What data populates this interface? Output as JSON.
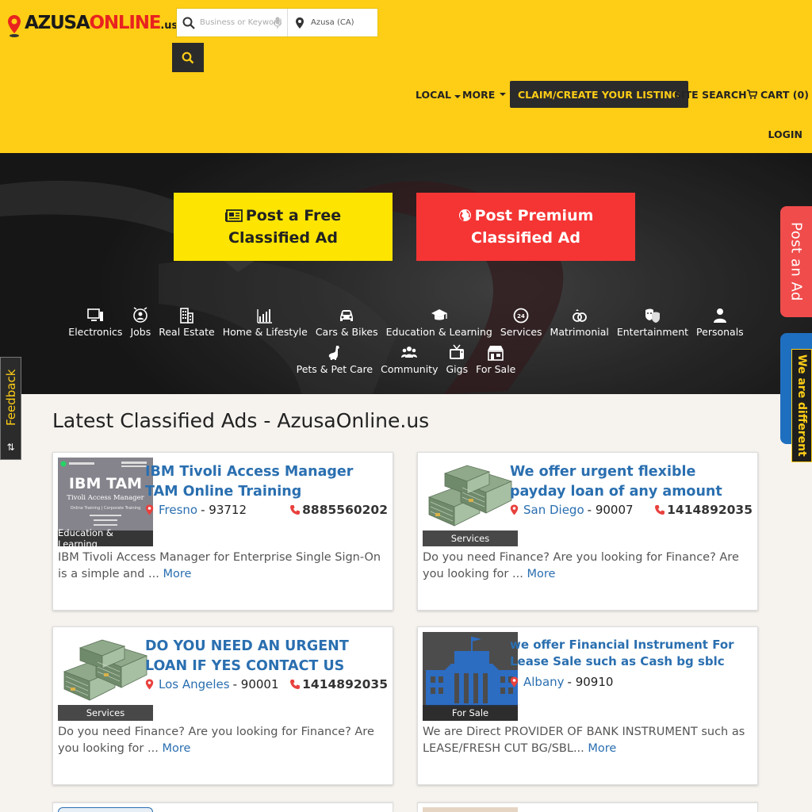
{
  "header": {
    "logo": {
      "main": "AZUSA",
      "accent": "ONLINE",
      "tld": ".us"
    },
    "search": {
      "keyword_placeholder": "Business or Keyword",
      "location_value": "Azusa (CA)",
      "icons": [
        "search-icon",
        "microphone-icon",
        "map-marker-icon"
      ]
    },
    "nav": {
      "local": "LOCAL",
      "more": "MORE",
      "claim": "CLAIM/CREATE YOUR LISTING",
      "site_search": "SITE SEARCH",
      "cart": "CART (0)",
      "login": "LOGIN"
    },
    "colors": {
      "brand_yellow": "#fecd16",
      "dark": "#2b2b2b",
      "link_blue": "#2a6fb0",
      "red": "#f43534"
    }
  },
  "hero": {
    "post_free": "Post a Free Classified Ad",
    "post_premium": "Post Premium Classified Ad",
    "categories_row1": [
      {
        "label": "Electronics",
        "icon": "monitor-icon"
      },
      {
        "label": "Jobs",
        "icon": "clock-user-icon"
      },
      {
        "label": "Real Estate",
        "icon": "building-icon"
      },
      {
        "label": "Home & Lifestyle",
        "icon": "chart-house-icon"
      },
      {
        "label": "Cars & Bikes",
        "icon": "car-icon"
      },
      {
        "label": "Education & Learning",
        "icon": "graduation-cap-icon"
      },
      {
        "label": "Services",
        "icon": "24h-service-icon"
      },
      {
        "label": "Matrimonial",
        "icon": "rings-icon"
      },
      {
        "label": "Entertainment",
        "icon": "theater-icon"
      },
      {
        "label": "Personals",
        "icon": "person-icon"
      }
    ],
    "categories_row2": [
      {
        "label": "Pets & Pet Care",
        "icon": "dog-icon"
      },
      {
        "label": "Community",
        "icon": "group-icon"
      },
      {
        "label": "Gigs",
        "icon": "tv-icon"
      },
      {
        "label": "For Sale",
        "icon": "shop-icon"
      }
    ]
  },
  "side_tabs": {
    "post_ad": "Post an Ad",
    "we_are_different": "We are different",
    "feedback": "Feedback",
    "feedback_arrows": "⇅"
  },
  "listing": {
    "title": "Latest Classified Ads - AzusaOnline.us",
    "cards": [
      {
        "title": "IBM Tivoli Access Manager TAM Online Training",
        "category": "Education & Learning",
        "city": "Fresno",
        "zip": "- 93712",
        "phone": "8885560202",
        "desc": "IBM Tivoli Access Manager for Enterprise Single Sign-On is a simple and ...",
        "more": "More",
        "thumb": {
          "heading": "IBM TAM",
          "sub": "Tivoli Access Manager",
          "line": "Online Training | Corporate Training"
        }
      },
      {
        "title": "We offer urgent flexible payday loan of any amount",
        "category": "Services",
        "city": "San Diego",
        "zip": "- 90007",
        "phone": "1414892035",
        "desc": "Do you need Finance? Are you looking for Finance? Are you looking for ...",
        "more": "More"
      },
      {
        "title": "DO YOU NEED AN URGENT LOAN IF YES CONTACT US",
        "category": "Services",
        "city": "Los Angeles",
        "zip": "- 90001",
        "phone": "1414892035",
        "desc": "Do you need Finance? Are you looking for Finance? Are you looking for ...",
        "more": "More"
      },
      {
        "title": "we offer Financial Instrument For Lease Sale such as Cash bg sblc",
        "category": "For Sale",
        "city": "Albany",
        "zip": "- 90910",
        "phone": "",
        "desc": "We are Direct PROVIDER OF BANK INSTRUMENT such as LEASE/FRESH CUT BG/SBL...",
        "more": "More"
      }
    ]
  }
}
